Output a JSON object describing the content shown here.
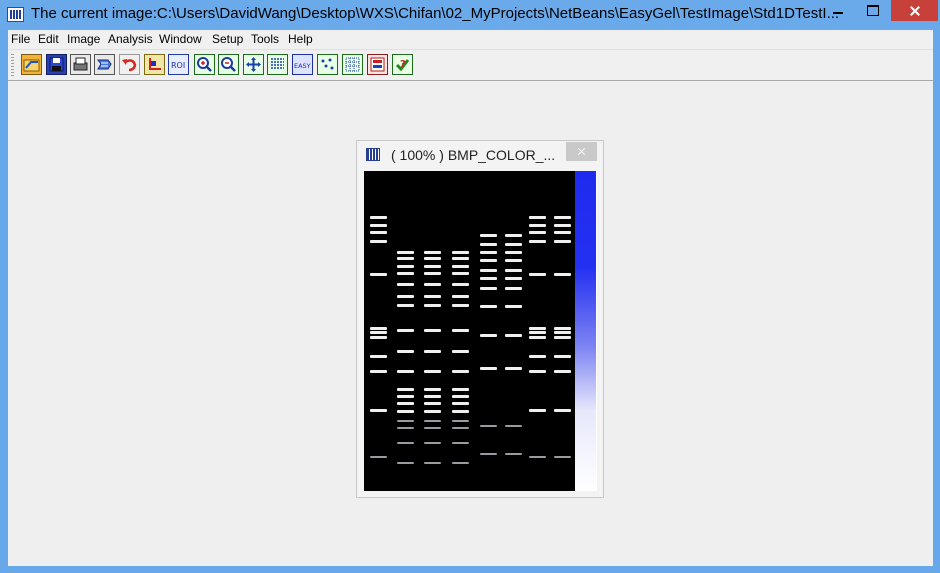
{
  "window": {
    "title": "The current image:C:\\Users\\DavidWang\\Desktop\\WXS\\Chifan\\02_MyProjects\\NetBeans\\EasyGel\\TestImage\\Std1DTestI...",
    "accent_color": "#6aaaeb",
    "close_color": "#c7413a"
  },
  "menu": {
    "items": [
      "File",
      "Edit",
      "Image",
      "Analysis",
      "Window",
      "Setup",
      "Tools",
      "Help"
    ]
  },
  "toolbar": {
    "buttons": [
      "open-icon",
      "save-icon",
      "print-icon",
      "print-preview-icon",
      "undo-icon",
      "crop-icon",
      "roi-icon",
      "zoom-in-icon",
      "zoom-out-icon",
      "pan-icon",
      "lane-icon",
      "easy-icon",
      "spots-icon",
      "grid-icon",
      "report-icon",
      "help-icon"
    ],
    "roi_label": "ROI",
    "easy_label": "EASY"
  },
  "image_window": {
    "zoom": "( 100% )",
    "name": "BMP_COLOR_...",
    "colorbar": [
      "#1f2af0",
      "#7d84f3",
      "#ffffff"
    ]
  }
}
